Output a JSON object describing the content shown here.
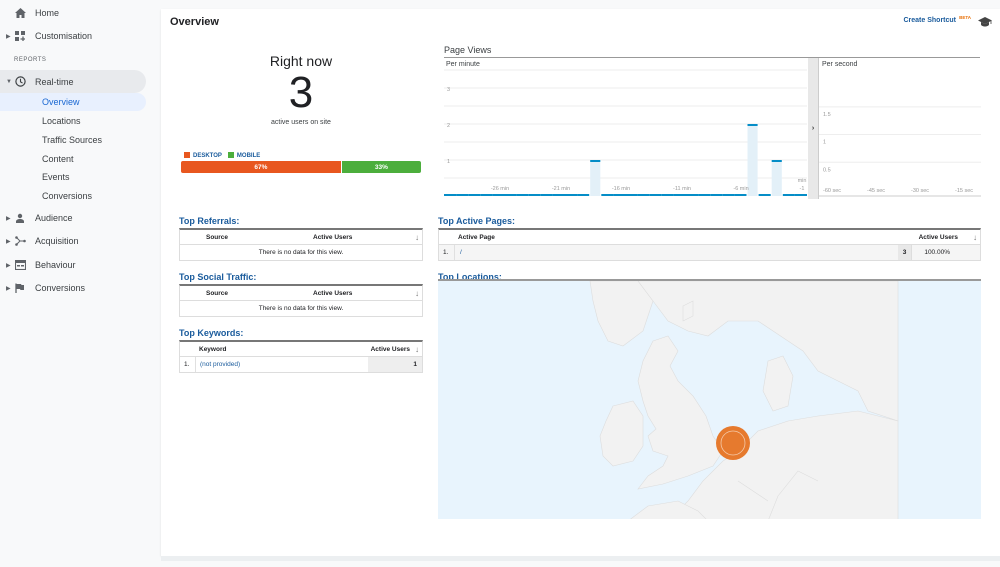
{
  "sidebar": {
    "top_items": [
      {
        "label": "Home",
        "icon": "home-icon"
      },
      {
        "label": "Customisation",
        "icon": "dashboard-grid-icon"
      }
    ],
    "reports_label": "REPORTS",
    "realtime": {
      "label": "Real-time",
      "icon": "clock-icon",
      "sub_items": [
        {
          "label": "Overview",
          "active": true
        },
        {
          "label": "Locations"
        },
        {
          "label": "Traffic Sources"
        },
        {
          "label": "Content"
        },
        {
          "label": "Events"
        },
        {
          "label": "Conversions"
        }
      ]
    },
    "bottom_items": [
      {
        "label": "Audience",
        "icon": "person-icon"
      },
      {
        "label": "Acquisition",
        "icon": "acquisition-icon"
      },
      {
        "label": "Behaviour",
        "icon": "behaviour-icon"
      },
      {
        "label": "Conversions",
        "icon": "flag-icon"
      }
    ]
  },
  "header": {
    "title": "Overview",
    "create_shortcut": "Create Shortcut",
    "beta": "BETA",
    "cap_icon": "graduation-cap-icon"
  },
  "right_now": {
    "title": "Right now",
    "count": "3",
    "subtitle": "active users on site",
    "legend": [
      {
        "label": "DESKTOP",
        "color": "#e8571f"
      },
      {
        "label": "MOBILE",
        "color": "#4cae3c"
      }
    ],
    "desktop_percent": 67,
    "mobile_percent": 33,
    "desktop_label": "67%",
    "mobile_label": "33%"
  },
  "page_views": {
    "title": "Page Views",
    "expand_icon": "chevron-right-icon"
  },
  "chart_data": [
    {
      "type": "bar",
      "title": "Per minute",
      "ylabel": "",
      "xlabel": "",
      "ylim": [
        0,
        3.5
      ],
      "yticks": [
        "1",
        "2",
        "3"
      ],
      "xtick_labels": [
        "-26 min",
        "-21 min",
        "-16 min",
        "-11 min",
        "-6 min",
        "min -1"
      ],
      "x": [
        -30,
        -29,
        -28,
        -27,
        -26,
        -25,
        -24,
        -23,
        -22,
        -21,
        -20,
        -19,
        -18,
        -17,
        -16,
        -15,
        -14,
        -13,
        -12,
        -11,
        -10,
        -9,
        -8,
        -7,
        -6,
        -5,
        -4,
        -3,
        -2,
        -1
      ],
      "values": [
        0,
        0,
        0,
        0,
        0,
        0,
        0,
        0,
        0,
        0,
        0,
        0,
        1,
        0,
        0,
        0,
        0,
        0,
        0,
        0,
        0,
        0,
        0,
        0,
        0,
        2,
        0,
        1,
        0,
        0
      ],
      "grid": true,
      "bar_color": "#058dc7",
      "bar_fill": "#e3f0f8"
    },
    {
      "type": "bar",
      "title": "Per second",
      "ylim": [
        0,
        2
      ],
      "yticks": [
        "0.5",
        "1",
        "1.5"
      ],
      "xtick_labels": [
        "-60 sec",
        "-45 sec",
        "-30 sec",
        "-15 sec"
      ],
      "values": [],
      "grid": true
    }
  ],
  "top_referrals": {
    "title": "Top Referrals:",
    "columns": [
      "Source",
      "Active Users"
    ],
    "empty_text": "There is no data for this view."
  },
  "top_social": {
    "title": "Top Social Traffic:",
    "columns": [
      "Source",
      "Active Users"
    ],
    "empty_text": "There is no data for this view."
  },
  "top_keywords": {
    "title": "Top Keywords:",
    "columns": [
      "Keyword",
      "Active Users"
    ],
    "rows": [
      {
        "num": "1.",
        "keyword": "(not provided)",
        "users": "1"
      }
    ]
  },
  "top_pages": {
    "title": "Top Active Pages:",
    "columns": [
      "Active Page",
      "Active Users"
    ],
    "rows": [
      {
        "num": "1.",
        "page": "/",
        "users": "3",
        "percent": "100.00%"
      }
    ]
  },
  "top_locations": {
    "title": "Top Locations:",
    "marker_color": "#e67a2e",
    "sea_color": "#e8f4fd",
    "land_color": "#f2f2f2"
  }
}
